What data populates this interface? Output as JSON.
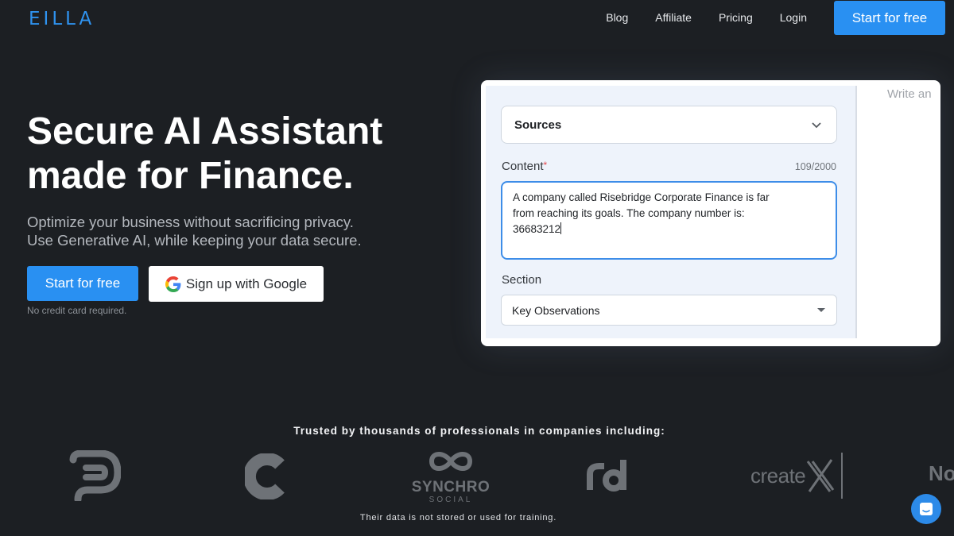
{
  "header": {
    "logo": "EILLA",
    "nav": [
      "Blog",
      "Affiliate",
      "Pricing",
      "Login"
    ],
    "cta": "Start for free"
  },
  "hero": {
    "title_line1": "Secure AI Assistant",
    "title_line2": "made for Finance.",
    "sub_line1": "Optimize your business without sacrificing privacy.",
    "sub_line2": "Use Generative AI, while keeping your data secure.",
    "primary_button": "Start for free",
    "google_button": "Sign up with Google",
    "note": "No credit card required."
  },
  "form": {
    "sources_label": "Sources",
    "content_label": "Content",
    "required_mark": "*",
    "counter": "109/2000",
    "content_line1": "A company called Risebridge Corporate Finance is far",
    "content_line2": "from reaching its goals. The company number is:",
    "content_line3": "36683212",
    "section_label": "Section",
    "section_value": "Key Observations",
    "side_placeholder": "Write an"
  },
  "trusted": {
    "heading": "Trusted by thousands of professionals in companies including:",
    "logos": [
      "synchro-logo",
      "rd-logo",
      "createx-logo"
    ],
    "synchro_name": "SYNCHRO",
    "synchro_sub": "SOCIAL",
    "createx_name": "create",
    "cut_logo": "No",
    "disclaimer": "Their data is not stored or used for training."
  },
  "colors": {
    "background": "#1c1f23",
    "accent": "#2990f2",
    "logo": "#2f93f0"
  }
}
